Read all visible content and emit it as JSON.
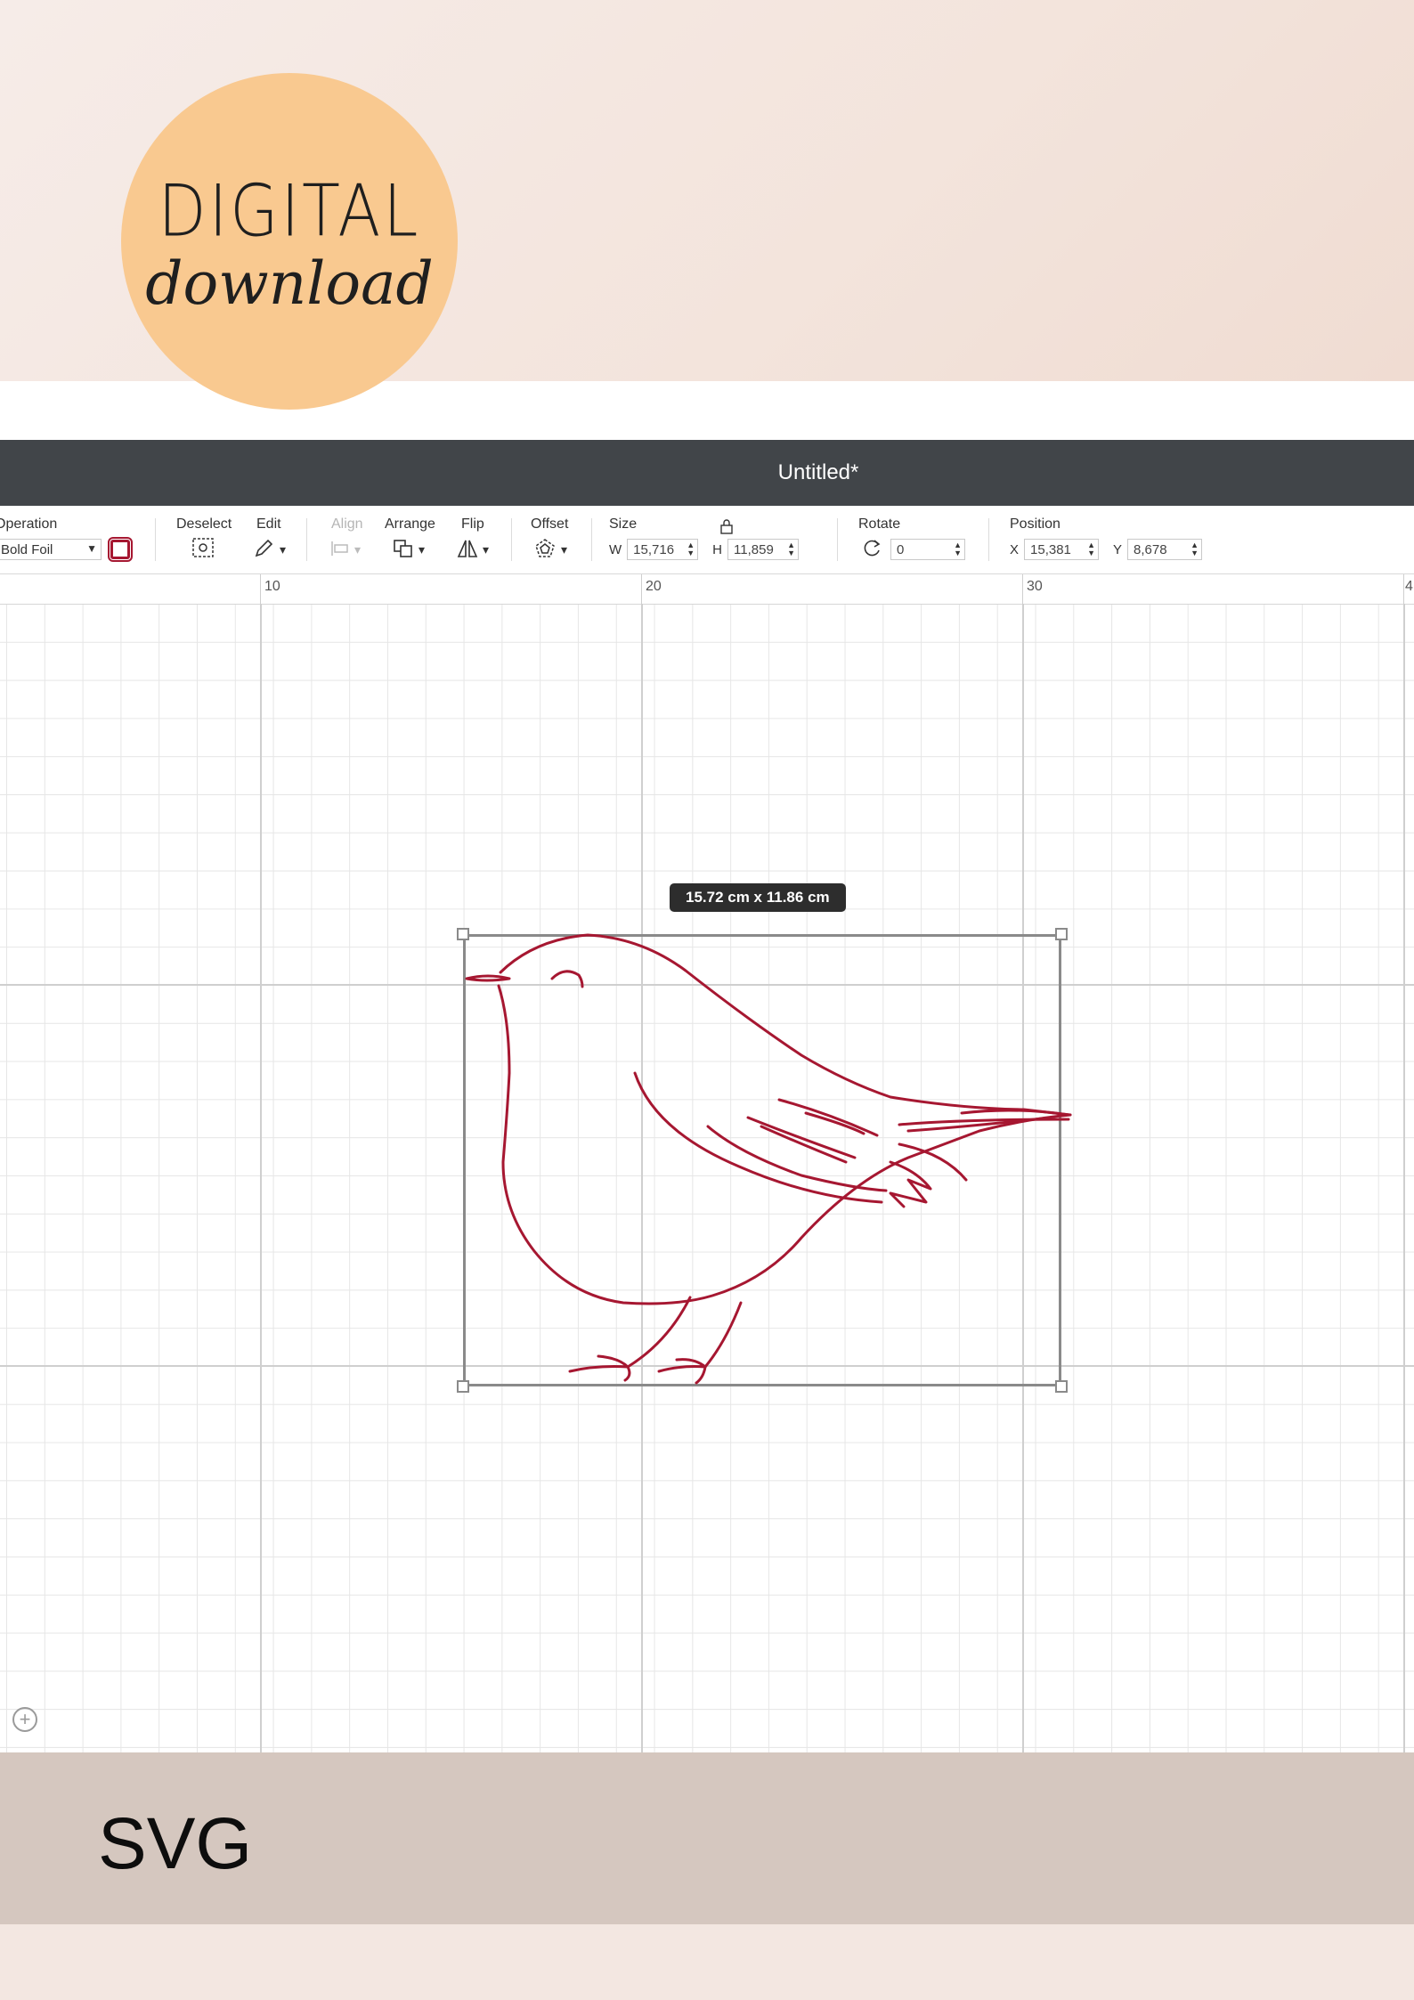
{
  "badge": {
    "line1": "DIGITAL",
    "line2": "download"
  },
  "window": {
    "title": "Untitled*"
  },
  "toolbar": {
    "operation": {
      "label": "Operation",
      "value": "Bold Foil",
      "swatch_color": "#a61731"
    },
    "deselect": {
      "label": "Deselect",
      "icon": "deselect-icon"
    },
    "edit": {
      "label": "Edit",
      "icon": "pencil-icon"
    },
    "align": {
      "label": "Align",
      "icon": "align-icon",
      "enabled": false
    },
    "arrange": {
      "label": "Arrange",
      "icon": "arrange-icon"
    },
    "flip": {
      "label": "Flip",
      "icon": "flip-icon"
    },
    "offset": {
      "label": "Offset",
      "icon": "offset-icon"
    },
    "size": {
      "label": "Size",
      "w_label": "W",
      "w": "15,716",
      "h_label": "H",
      "h": "11,859",
      "lock_icon": "lock-icon"
    },
    "rotate": {
      "label": "Rotate",
      "value": "0",
      "icon": "rotate-icon"
    },
    "position": {
      "label": "Position",
      "x_label": "X",
      "x": "15,381",
      "y_label": "Y",
      "y": "8,678"
    }
  },
  "ruler": {
    "labels": [
      "10",
      "20",
      "30",
      "4"
    ]
  },
  "canvas": {
    "selection_size": "15.72  cm x 11.86  cm",
    "stroke_color": "#a61731",
    "zoom_icon": "zoom-in-icon"
  },
  "footer": {
    "label": "SVG"
  }
}
